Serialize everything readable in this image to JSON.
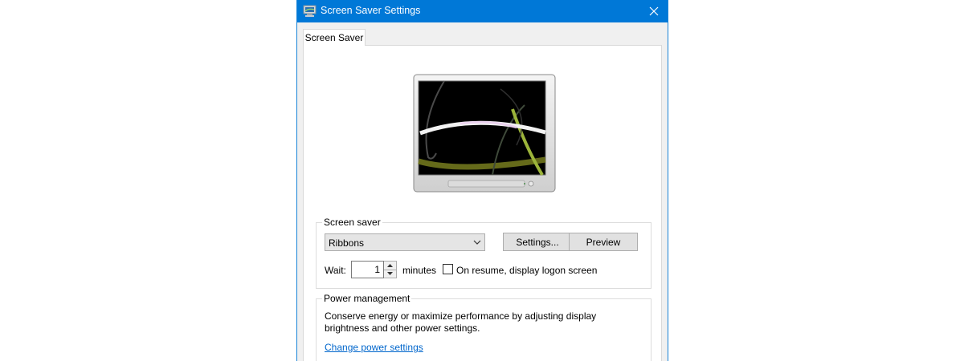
{
  "window": {
    "title": "Screen Saver Settings",
    "accent": "#0078d7"
  },
  "tabs": [
    {
      "label": "Screen Saver",
      "active": true
    }
  ],
  "preview": {
    "screensaver_image": "ribbons-preview"
  },
  "screen_saver": {
    "group_label": "Screen saver",
    "selected": "Ribbons",
    "settings_label": "Settings...",
    "preview_label": "Preview",
    "wait_label": "Wait:",
    "wait_value": "1",
    "minutes_label": "minutes",
    "resume_label": "On resume, display logon screen",
    "resume_checked": false
  },
  "power": {
    "group_label": "Power management",
    "description": "Conserve energy or maximize performance by adjusting display brightness and other power settings.",
    "link_label": "Change power settings"
  },
  "icons": {
    "app": "screen-saver-icon",
    "close": "close-icon",
    "dropdown": "chevron-down-icon",
    "spin_up": "arrow-up-icon",
    "spin_down": "arrow-down-icon"
  }
}
